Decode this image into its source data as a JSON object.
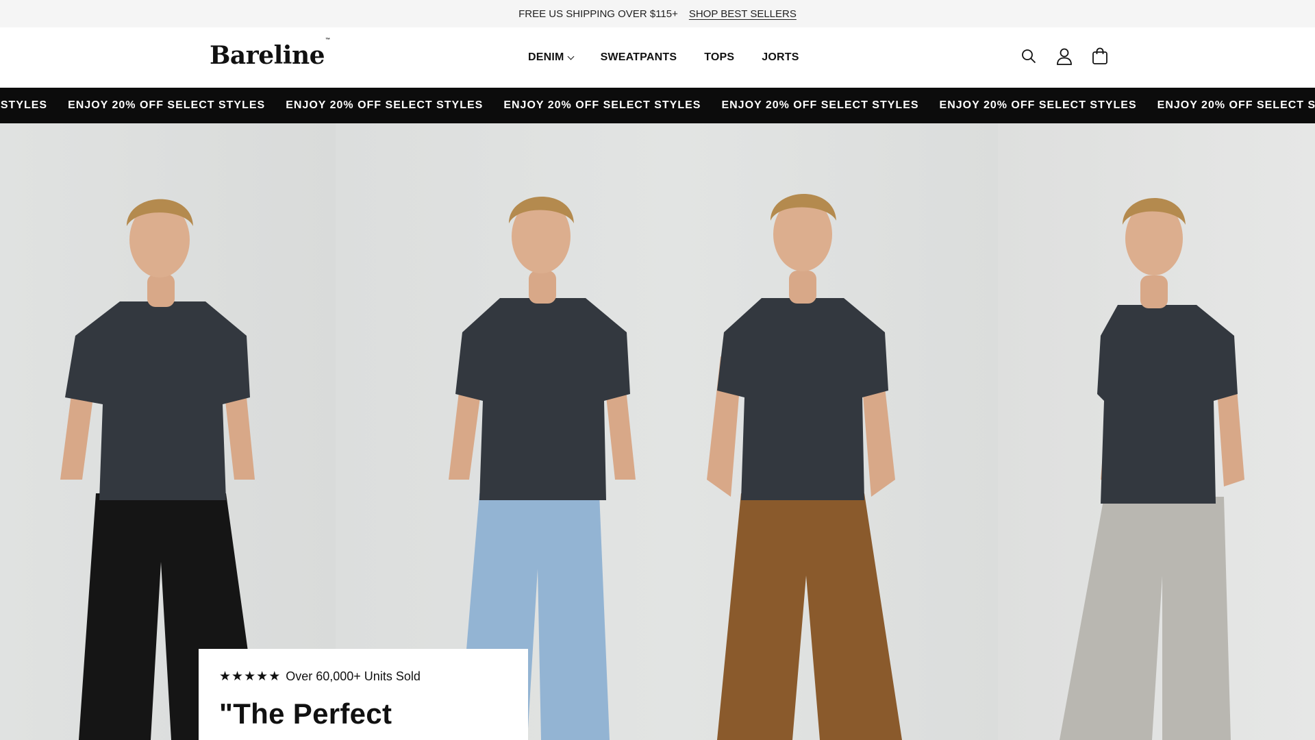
{
  "announcement": {
    "text": "FREE US SHIPPING OVER $115+",
    "link": "SHOP BEST SELLERS"
  },
  "header": {
    "logo": "Bareline",
    "logo_mark": "™",
    "nav": [
      {
        "label": "DENIM",
        "has_dropdown": true
      },
      {
        "label": "SWEATPANTS",
        "has_dropdown": false
      },
      {
        "label": "TOPS",
        "has_dropdown": false
      },
      {
        "label": "JORTS",
        "has_dropdown": false
      }
    ],
    "icons": [
      "search-icon",
      "account-icon",
      "cart-icon"
    ]
  },
  "promo": {
    "text": "ENJOY 20% OFF SELECT STYLES",
    "background": "#0c0c0c"
  },
  "hero": {
    "panels": [
      {
        "pants_color": "#151515",
        "pants": "black wide-leg jeans"
      },
      {
        "pants_color": "#93b4d3",
        "pants": "light blue wide-leg jeans"
      },
      {
        "pants_color": "#8a5a2c",
        "pants": "brown wash wide-leg jeans"
      },
      {
        "pants_color": "#b9b7b1",
        "pants": "grey sweatpants"
      }
    ],
    "shirt_color": "#33383f"
  },
  "review": {
    "stars": 5,
    "units_text": "Over 60,000+ Units Sold",
    "headline": "\"The Perfect"
  }
}
